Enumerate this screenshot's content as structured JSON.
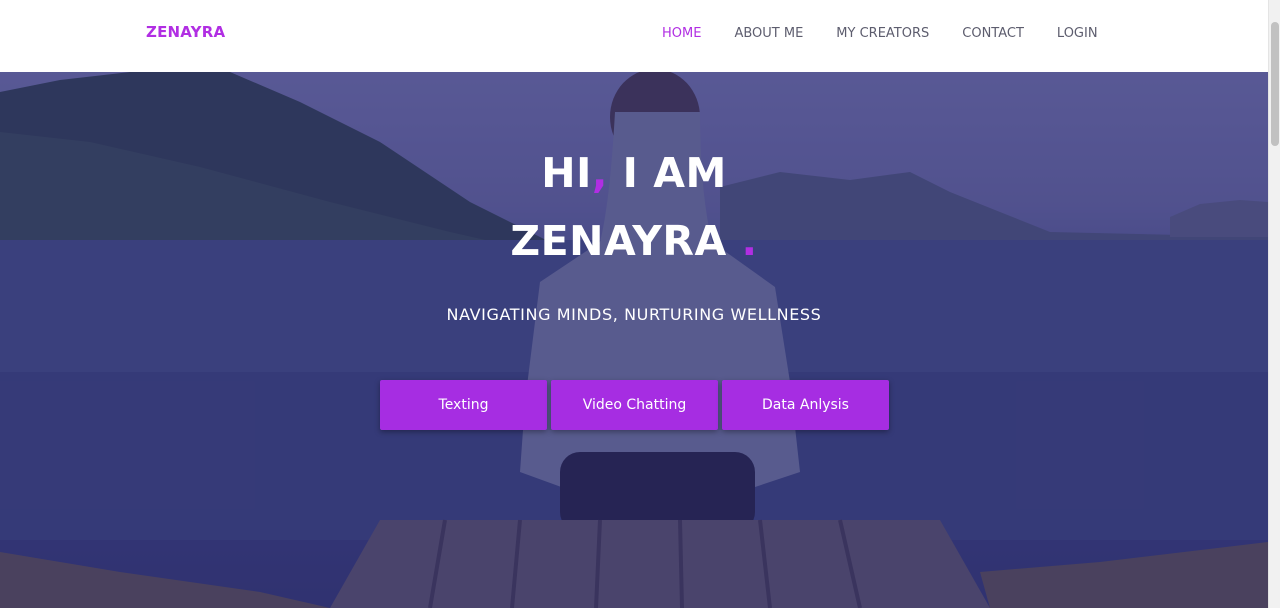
{
  "brand": {
    "name": "ZENAYRA",
    "color": "#b12ee3"
  },
  "nav": {
    "items": [
      {
        "label": "HOME",
        "active": true
      },
      {
        "label": "ABOUT ME",
        "active": false
      },
      {
        "label": "MY CREATORS",
        "active": false
      },
      {
        "label": "CONTACT",
        "active": false
      },
      {
        "label": "LOGIN",
        "active": false
      }
    ]
  },
  "hero": {
    "greeting_part1": "HI",
    "greeting_comma": ",",
    "greeting_part2": " I AM",
    "name": "ZENAYRA ",
    "name_dot": ".",
    "tagline": "NAVIGATING MINDS, NURTURING WELLNESS",
    "buttons": [
      {
        "label": "Texting"
      },
      {
        "label": "Video Chatting"
      },
      {
        "label": "Data Anlysis"
      }
    ]
  },
  "colors": {
    "accent": "#b12ee3",
    "button": "#a62de2",
    "overlay": "#2e2876"
  }
}
